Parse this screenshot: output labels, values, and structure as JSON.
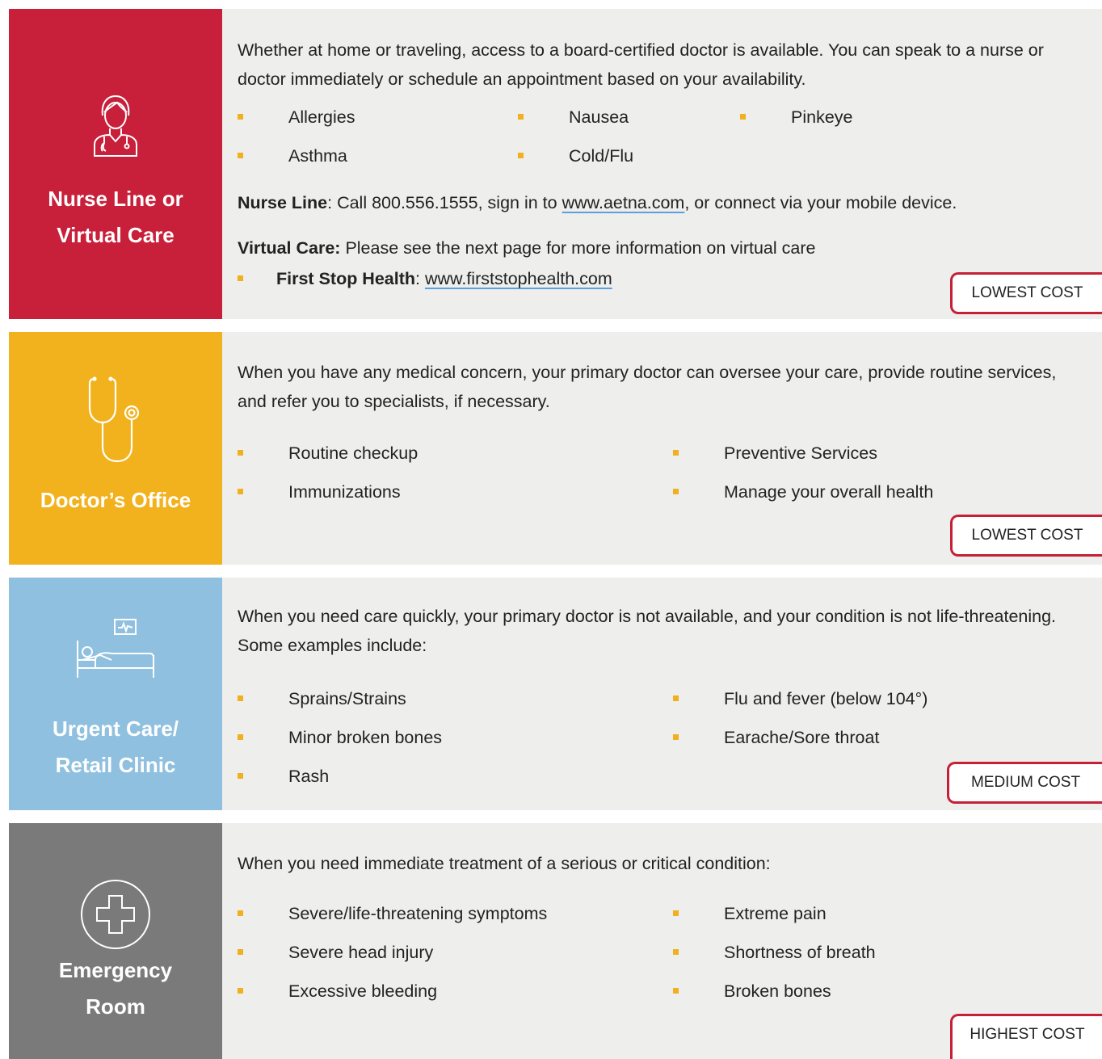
{
  "colors": {
    "nurse": "#c8203a",
    "doctor": "#f2b21d",
    "urgent": "#8fc0e0",
    "er": "#7a7a7a",
    "panel": "#eeeeec",
    "bullet": "#f0b020",
    "cost_border": "#c52036"
  },
  "sections": [
    {
      "title_line1": "Nurse Line or",
      "title_line2": "Virtual Care",
      "icon": "nurse-icon",
      "intro": "Whether at home or traveling, access to a board-certified doctor is available. You can speak to a nurse or doctor immediately or schedule an appointment based on your availability.",
      "bullets": [
        "Allergies",
        "Nausea",
        "Pinkeye",
        "Asthma",
        "Cold/Flu"
      ],
      "nurse_line_label": "Nurse Line",
      "nurse_line_text_1": ": Call 800.556.1555, sign in to ",
      "nurse_line_link": "www.aetna.com",
      "nurse_line_text_2": ", or connect via your mobile device.",
      "virtual_care_label": "Virtual Care:",
      "virtual_care_text": " Please see the next page for more information on virtual care",
      "fsh_label": "First Stop Health",
      "fsh_sep": ": ",
      "fsh_link": "www.firststophealth.com",
      "cost": "LOWEST COST"
    },
    {
      "title": "Doctor’s Office",
      "icon": "stethoscope-icon",
      "intro": "When you have any medical concern, your primary doctor can oversee your care, provide routine services, and refer you to specialists, if necessary.",
      "bullets": [
        "Routine checkup",
        "Preventive Services",
        "Immunizations",
        "Manage your overall health"
      ],
      "cost": "LOWEST COST"
    },
    {
      "title_line1": "Urgent Care/",
      "title_line2": "Retail Clinic",
      "icon": "hospital-bed-icon",
      "intro": "When you need care quickly, your primary doctor is not available, and your condition is not life-threatening. Some examples include:",
      "bullets": [
        "Sprains/Strains",
        "Flu and fever (below 104°)",
        "Minor broken bones",
        "Earache/Sore throat",
        "Rash"
      ],
      "cost": "MEDIUM COST"
    },
    {
      "title_line1": "Emergency",
      "title_line2": "Room",
      "icon": "medical-cross-icon",
      "intro": "When you need immediate treatment of a serious or critical condition:",
      "bullets": [
        "Severe/life-threatening symptoms",
        "Extreme pain",
        "Severe head injury",
        "Shortness of breath",
        "Excessive bleeding",
        "Broken bones"
      ],
      "cost": "HIGHEST COST"
    }
  ]
}
